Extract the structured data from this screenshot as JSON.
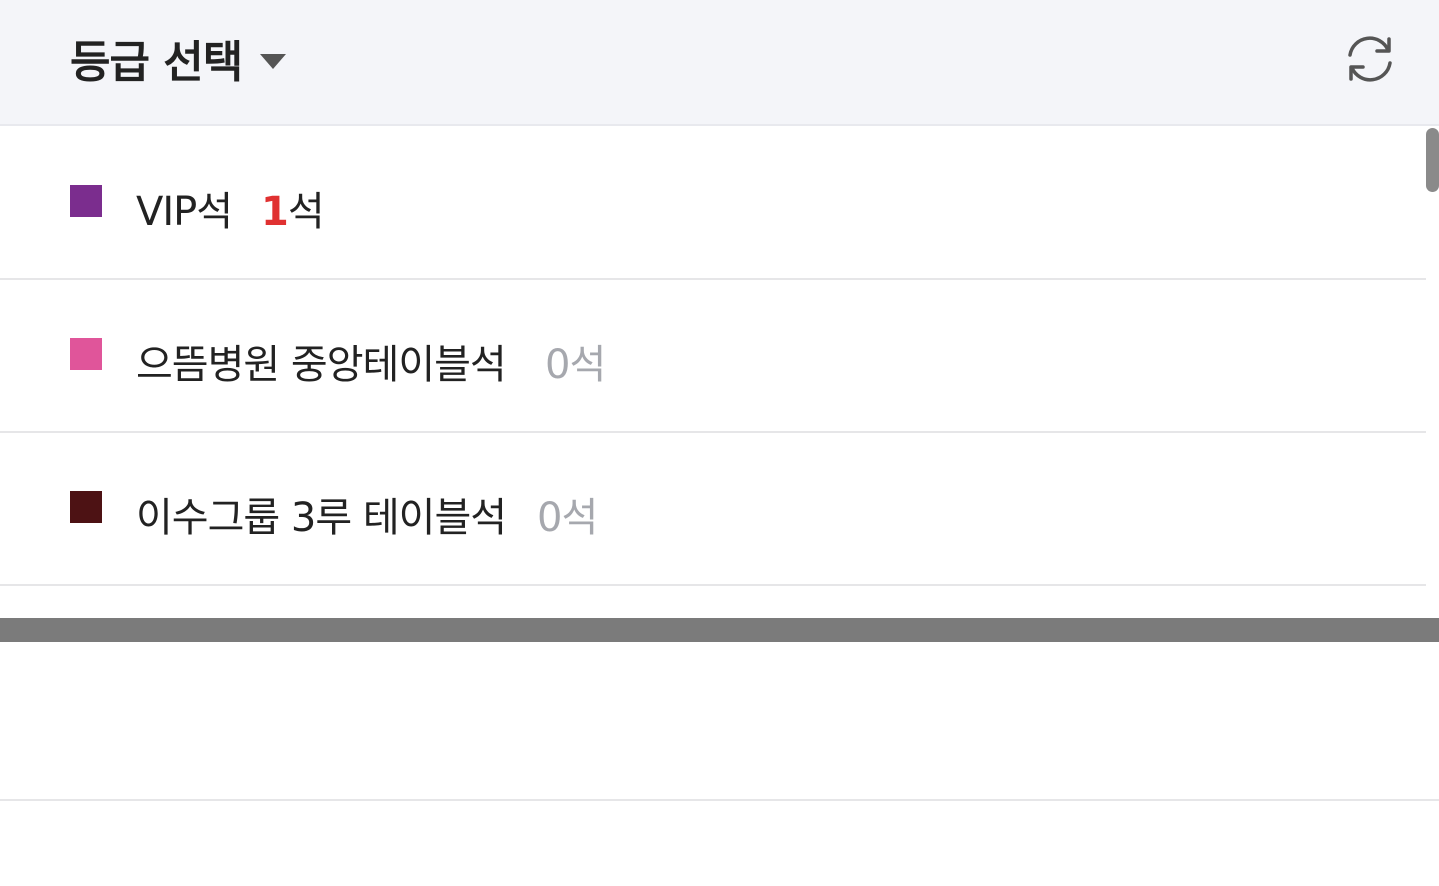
{
  "header": {
    "title": "등급 선택",
    "refresh_icon": "refresh-icon",
    "caret_icon": "caret-down-icon"
  },
  "grades": [
    {
      "label": "VIP석",
      "count": "1",
      "suffix": "석",
      "color": "#7b2d8e",
      "count_color": "#e03131"
    },
    {
      "label": "으뜸병원 중앙테이블석",
      "count": "0석",
      "color": "#e0559a",
      "count_color": "#a6a8ae"
    },
    {
      "label": "이수그룹 3루 테이블석",
      "count": "0석",
      "color": "#4d1214",
      "count_color": "#a6a8ae"
    }
  ],
  "colors": {
    "header_bg": "#f4f5f9",
    "splitter": "#7b7b7b",
    "divider": "#e6e6e8"
  }
}
